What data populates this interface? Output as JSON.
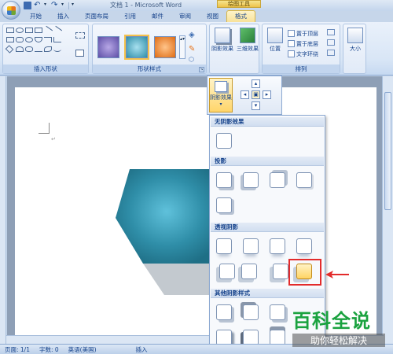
{
  "title_bar": {
    "document_title": "文档 1 - Microsoft Word",
    "context_title": "绘图工具"
  },
  "tabs": [
    "开始",
    "插入",
    "页面布局",
    "引用",
    "邮件",
    "审阅",
    "视图",
    "格式"
  ],
  "ribbon": {
    "groups": {
      "insert_shapes": "插入形状",
      "shape_styles": "形状样式",
      "arrange": "排列"
    },
    "shadow_effects": "阴影效果",
    "effects_3d": "三维效果",
    "position": "位置",
    "bring_to_front": "置于顶层",
    "send_to_back": "置于底层",
    "text_wrapping": "文字环绕",
    "size": "大小"
  },
  "popup": {
    "shadow_effects_label": "阴影效果",
    "sections": {
      "no_shadow": "无阴影效果",
      "drop_shadow": "投影",
      "perspective_shadow": "透视阴影",
      "other_shadow_styles": "其他阴影样式"
    }
  },
  "status_bar": {
    "page": "页面: 1/1",
    "words": "字数: 0",
    "language": "英语(美国)",
    "mode": "插入"
  },
  "watermark": {
    "brand": "百科全说",
    "slogan": "助你轻松解决"
  },
  "colors": {
    "accent_red": "#e32b2b",
    "shape_teal": "#2f8ea8",
    "watermark_green": "#1aa23f"
  }
}
